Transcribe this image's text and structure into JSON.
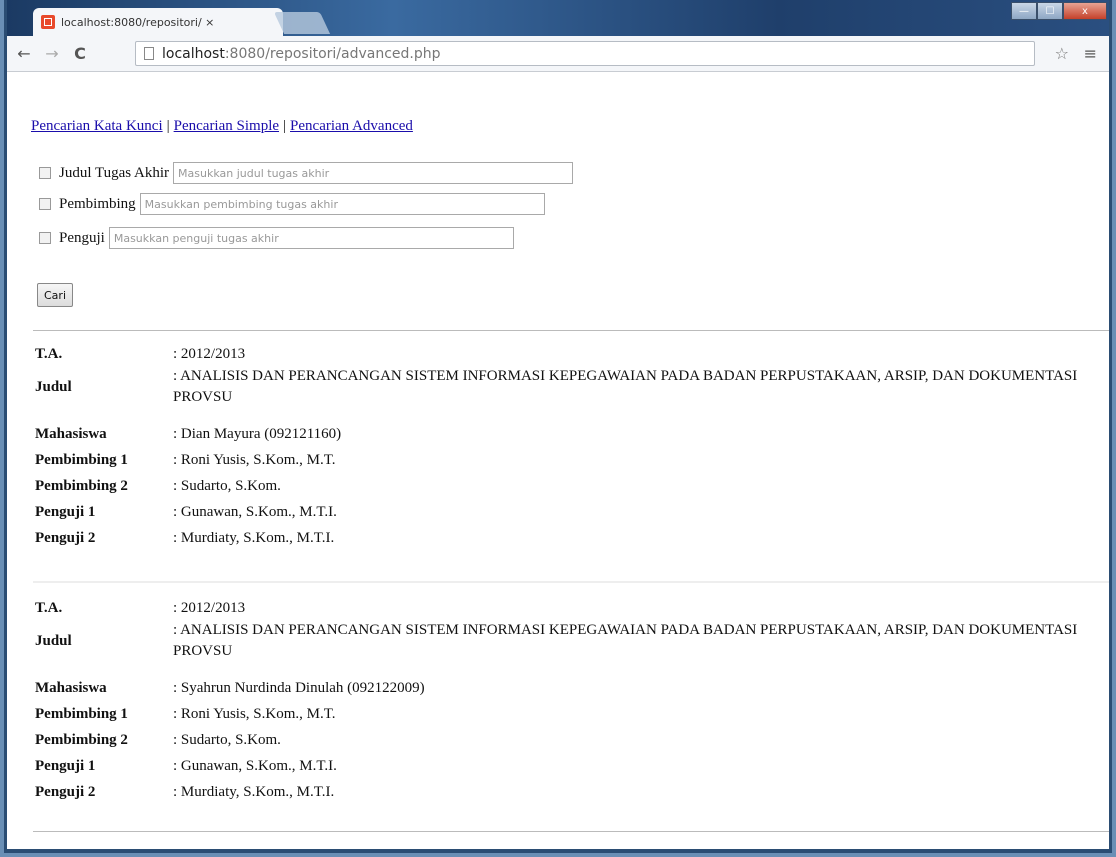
{
  "browser": {
    "tab_title": "localhost:8080/repositori/ ×",
    "tab_close": "×",
    "url_host": "localhost",
    "url_rest": ":8080/repositori/advanced.php",
    "back": "←",
    "forward": "→",
    "reload": "C",
    "star": "☆",
    "menu": "≡",
    "window_controls": {
      "min": "—",
      "max": "☐",
      "close": "x"
    }
  },
  "nav_links": [
    {
      "label": "Pencarian Kata Kunci"
    },
    {
      "label": "Pencarian Simple"
    },
    {
      "label": "Pencarian Advanced"
    }
  ],
  "nav_separator": "|",
  "form": {
    "fields": [
      {
        "label": "Judul Tugas Akhir",
        "placeholder": "Masukkan judul tugas akhir"
      },
      {
        "label": "Pembimbing",
        "placeholder": "Masukkan pembimbing tugas akhir"
      },
      {
        "label": "Penguji",
        "placeholder": "Masukkan penguji tugas akhir"
      }
    ],
    "search_button": "Cari"
  },
  "results": [
    {
      "rows": [
        {
          "label": "T.A.",
          "value": ": 2012/2013"
        },
        {
          "label": "Judul",
          "value": ": ANALISIS DAN PERANCANGAN SISTEM INFORMASI KEPEGAWAIAN PADA BADAN PERPUSTAKAAN, ARSIP, DAN DOKUMENTASI PROVSU"
        },
        {
          "label": "Mahasiswa",
          "value": ": Dian Mayura (092121160)"
        },
        {
          "label": "Pembimbing 1",
          "value": ": Roni Yusis, S.Kom., M.T."
        },
        {
          "label": "Pembimbing 2",
          "value": ": Sudarto, S.Kom."
        },
        {
          "label": "Penguji 1",
          "value": ": Gunawan, S.Kom., M.T.I."
        },
        {
          "label": "Penguji 2",
          "value": ": Murdiaty, S.Kom., M.T.I."
        }
      ]
    },
    {
      "rows": [
        {
          "label": "T.A.",
          "value": ": 2012/2013"
        },
        {
          "label": "Judul",
          "value": ": ANALISIS DAN PERANCANGAN SISTEM INFORMASI KEPEGAWAIAN PADA BADAN PERPUSTAKAAN, ARSIP, DAN DOKUMENTASI PROVSU"
        },
        {
          "label": "Mahasiswa",
          "value": ": Syahrun Nurdinda Dinulah (092122009)"
        },
        {
          "label": "Pembimbing 1",
          "value": ": Roni Yusis, S.Kom., M.T."
        },
        {
          "label": "Pembimbing 2",
          "value": ": Sudarto, S.Kom."
        },
        {
          "label": "Penguji 1",
          "value": ": Gunawan, S.Kom., M.T.I."
        },
        {
          "label": "Penguji 2",
          "value": ": Murdiaty, S.Kom., M.T.I."
        }
      ]
    }
  ]
}
